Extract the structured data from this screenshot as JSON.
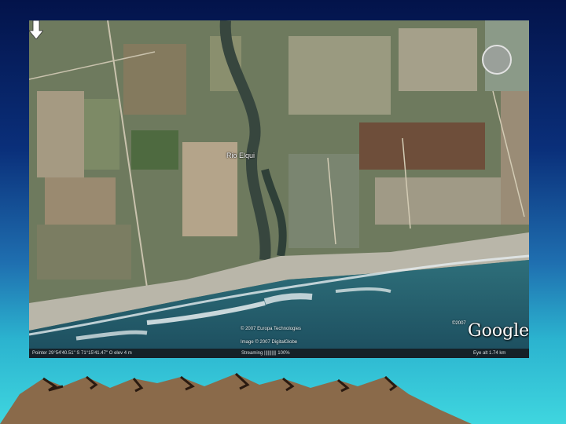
{
  "map": {
    "place_label": "Rio Elqui",
    "copyright_lines": [
      "© 2007 Europa Technologies",
      "Image © 2007 DigitalGlobe"
    ],
    "logo": {
      "prefix": "©2007",
      "brand": "Google"
    },
    "status_bar": {
      "pointer": "Pointer  29°54'40.51\" S    71°15'41.47\" O    elev    4 m",
      "streaming": "Streaming |||||||||| 100%",
      "eye_alt": "Eye alt   1.74 km"
    }
  },
  "colors": {
    "background_top": "#03134a",
    "background_bottom": "#3fd6df",
    "mountain": "#8a6a4a",
    "mountain_snow": "#2a1a10"
  },
  "icons": [
    "down-arrow-marker-icon"
  ]
}
